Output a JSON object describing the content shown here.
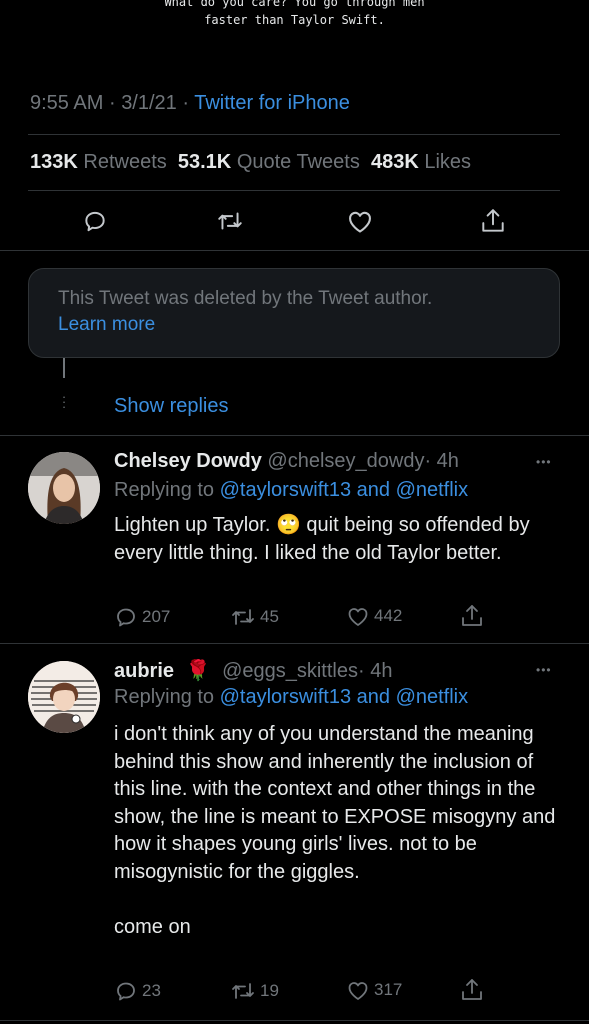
{
  "quoted_tweet_text_line1": "What do you care? You go through men",
  "quoted_tweet_text_line2": "faster than Taylor Swift.",
  "meta": {
    "time": "9:55 AM",
    "sep": "·",
    "date": "3/1/21",
    "source": "Twitter for iPhone"
  },
  "stats": {
    "retweets_count": "133K",
    "retweets_label": "Retweets",
    "quotes_count": "53.1K",
    "quotes_label": "Quote Tweets",
    "likes_count": "483K",
    "likes_label": "Likes"
  },
  "deleted": {
    "message": "This Tweet was deleted by the Tweet author.",
    "link": "Learn more"
  },
  "show_replies": "Show replies",
  "replies": [
    {
      "name": "Chelsey Dowdy",
      "handle": "@chelsey_dowdy",
      "time": "· 4h",
      "replying_prefix": "Replying to",
      "replying_to": "@taylorswift13 and @netflix",
      "text": "Lighten up Taylor. 🙄 quit being so offended by every little thing. I liked the old Taylor better.",
      "reply_count": "207",
      "retweet_count": "45",
      "like_count": "442",
      "more": "•••"
    },
    {
      "name": "aubrie",
      "emoji": "🌹",
      "handle": "@eggs_skittles",
      "time": "· 4h",
      "replying_prefix": "Replying to",
      "replying_to": "@taylorswift13 and @netflix",
      "text": "i don't think any of you understand the meaning behind this show and inherently the inclusion of this line. with the context and other things in the show, the line is meant to EXPOSE misogyny and how it shapes young girls' lives. not to be misogynistic for the giggles.\n\ncome on",
      "reply_count": "23",
      "retweet_count": "19",
      "like_count": "317",
      "more": "•••"
    }
  ],
  "colors": {
    "background": "#000000",
    "link": "#3b8fe0",
    "muted": "#71767b",
    "text": "#e7e9ea",
    "divider": "#2f3336",
    "card": "#15181c"
  }
}
